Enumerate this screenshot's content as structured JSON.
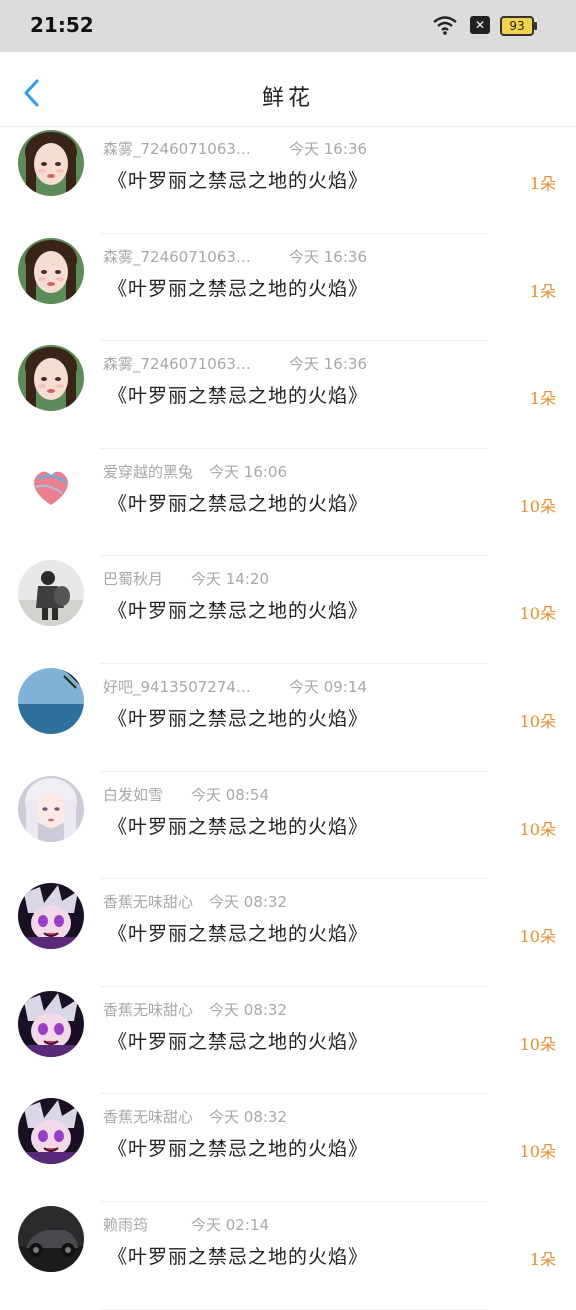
{
  "status_bar": {
    "time": "21:52",
    "battery": "93"
  },
  "header": {
    "title": "鲜花"
  },
  "list": [
    {
      "name": "森雾_7246071063…",
      "time": "今天 16:36",
      "book": "《叶罗丽之禁忌之地的火焰》",
      "count": "1朵",
      "avatar": "girl-portrait"
    },
    {
      "name": "森雾_7246071063…",
      "time": "今天 16:36",
      "book": "《叶罗丽之禁忌之地的火焰》",
      "count": "1朵",
      "avatar": "girl-portrait"
    },
    {
      "name": "森雾_7246071063…",
      "time": "今天 16:36",
      "book": "《叶罗丽之禁忌之地的火焰》",
      "count": "1朵",
      "avatar": "girl-portrait"
    },
    {
      "name": "爱穿越的黑兔",
      "time": "今天 16:06",
      "book": "《叶罗丽之禁忌之地的火焰》",
      "count": "10朵",
      "avatar": "heart-art"
    },
    {
      "name": "巴蜀秋月",
      "time": "今天 14:20",
      "book": "《叶罗丽之禁忌之地的火焰》",
      "count": "10朵",
      "avatar": "person-photo"
    },
    {
      "name": "好吧_9413507274…",
      "time": "今天 09:14",
      "book": "《叶罗丽之禁忌之地的火焰》",
      "count": "10朵",
      "avatar": "sea-view"
    },
    {
      "name": "白发如雪",
      "time": "今天 08:54",
      "book": "《叶罗丽之禁忌之地的火焰》",
      "count": "10朵",
      "avatar": "white-hair-girl"
    },
    {
      "name": "香蕉无味甜心",
      "time": "今天 08:32",
      "book": "《叶罗丽之禁忌之地的火焰》",
      "count": "10朵",
      "avatar": "anime-purple"
    },
    {
      "name": "香蕉无味甜心",
      "time": "今天 08:32",
      "book": "《叶罗丽之禁忌之地的火焰》",
      "count": "10朵",
      "avatar": "anime-purple"
    },
    {
      "name": "香蕉无味甜心",
      "time": "今天 08:32",
      "book": "《叶罗丽之禁忌之地的火焰》",
      "count": "10朵",
      "avatar": "anime-purple"
    },
    {
      "name": "赖雨筠",
      "time": "今天 02:14",
      "book": "《叶罗丽之禁忌之地的火焰》",
      "count": "1朵",
      "avatar": "car-photo"
    }
  ],
  "colors": {
    "accent": "#ef8c2a",
    "back_icon": "#2a9df4",
    "meta_text": "#a8a8a8"
  }
}
